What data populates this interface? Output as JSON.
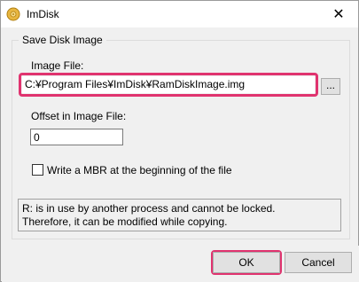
{
  "window": {
    "title": "ImDisk",
    "close_glyph": "✕",
    "app_icon": "imdisk-app-icon"
  },
  "group": {
    "title": "Save Disk Image"
  },
  "image_file": {
    "label": "Image File:",
    "value": "C:¥Program Files¥ImDisk¥RamDiskImage.img",
    "browse_label": "..."
  },
  "offset": {
    "label": "Offset in Image File:",
    "value": "0"
  },
  "mbr_checkbox": {
    "label": "Write a MBR at the beginning of the file",
    "checked": false
  },
  "info": {
    "line1": "R: is in use by another process and cannot be locked.",
    "line2": "Therefore, it can be modified while copying."
  },
  "buttons": {
    "ok": "OK",
    "cancel": "Cancel"
  },
  "colors": {
    "highlight": "#e0336f",
    "dialog_bg": "#f0f0f0"
  }
}
